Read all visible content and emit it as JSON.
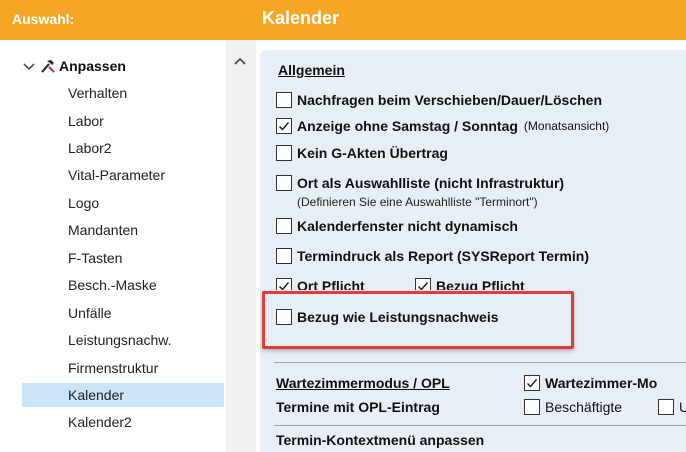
{
  "header": {
    "left_title": "Auswahl:",
    "right_title": "Kalender"
  },
  "sidebar": {
    "root_label": "Anpassen",
    "items": [
      "Verhalten",
      "Labor",
      "Labor2",
      "Vital-Parameter",
      "Logo",
      "Mandanten",
      "F-Tasten",
      "Besch.-Maske",
      "Unfälle",
      "Leistungsnachw.",
      "Firmenstruktur",
      "Kalender",
      "Kalender2"
    ],
    "selected": "Kalender"
  },
  "general": {
    "title": "Allgemein",
    "opt1": {
      "label": "Nachfragen beim Verschieben/Dauer/Löschen",
      "checked": false
    },
    "opt2": {
      "label": "Anzeige ohne Samstag / Sonntag",
      "note": "(Monatsansicht)",
      "checked": true
    },
    "opt3": {
      "label": "Kein G-Akten Übertrag",
      "checked": false
    },
    "opt4": {
      "label": "Ort als Auswahlliste (nicht Infrastruktur)",
      "checked": false
    },
    "opt4_hint": "(Definieren Sie eine Auswahlliste \"Terminort\")",
    "opt5": {
      "label": "Kalenderfenster nicht dynamisch",
      "checked": false
    },
    "opt6": {
      "label": "Termindruck als Report (SYSReport Termin)",
      "checked": false
    },
    "opt7": {
      "label": "Ort Pflicht",
      "checked": true
    },
    "opt8": {
      "label": "Bezug Pflicht",
      "checked": true
    },
    "opt9": {
      "label": "Bezug wie Leistungsnachweis",
      "checked": false
    }
  },
  "waiting": {
    "title": "Wartezimmermodus / OPL",
    "opt_waiting": {
      "label": "Wartezimmer-Mo",
      "checked": true
    },
    "opl_label": "Termine mit OPL-Eintrag",
    "opt_employed": {
      "label": "Beschäftigte",
      "checked": false
    },
    "opt_cut": {
      "label": "U",
      "checked": false
    }
  },
  "context": {
    "title": "Termin-Kontextmenü anpassen"
  },
  "colors": {
    "header": "#f5a623",
    "selected": "#cce4f7",
    "panel": "#e8eef5",
    "highlight": "#e03c3c"
  }
}
